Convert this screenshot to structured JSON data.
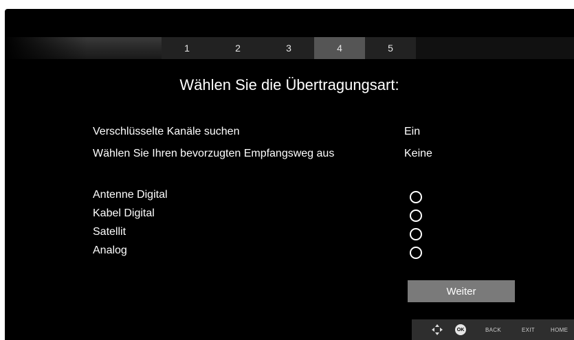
{
  "steps": [
    "1",
    "2",
    "3",
    "4",
    "5"
  ],
  "active_step": "4",
  "title": "Wählen Sie die Übertragungsart:",
  "settings": [
    {
      "label": "Verschlüsselte Kanäle suchen",
      "value": "Ein"
    },
    {
      "label": "Wählen Sie Ihren bevorzugten Empfangsweg aus",
      "value": "Keine"
    }
  ],
  "options": [
    {
      "label": "Antenne Digital",
      "selected": false
    },
    {
      "label": "Kabel Digital",
      "selected": false
    },
    {
      "label": "Satellit",
      "selected": false
    },
    {
      "label": "Analog",
      "selected": false
    }
  ],
  "next_button": "Weiter",
  "footer": {
    "ok": "OK",
    "back": "BACK",
    "exit": "EXIT",
    "home": "HOME"
  }
}
